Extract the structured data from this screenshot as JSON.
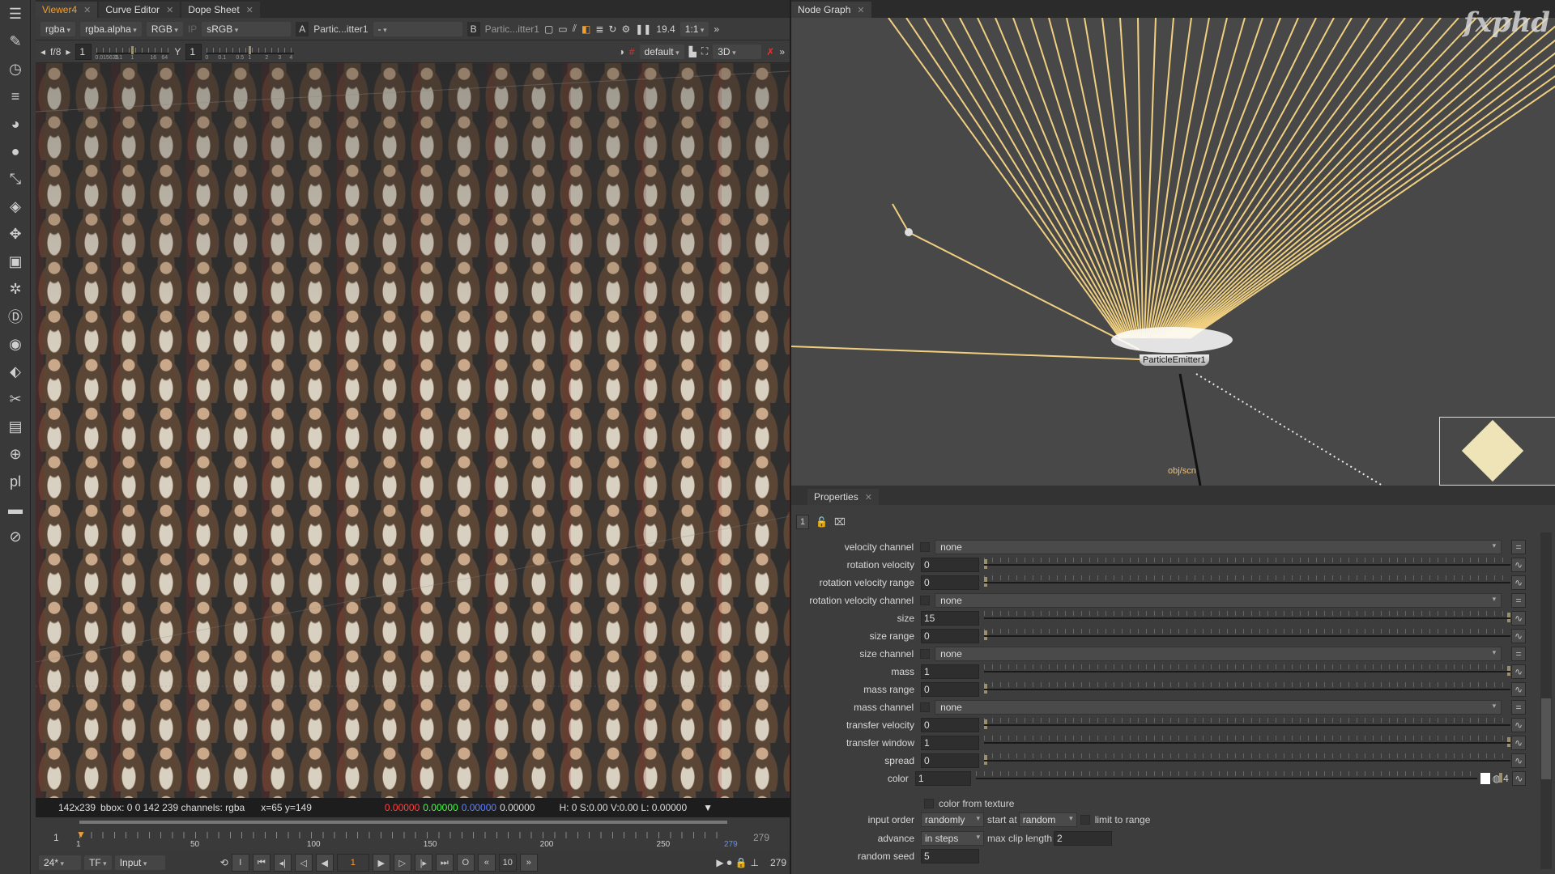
{
  "viewer": {
    "tabs": [
      {
        "label": "Viewer4",
        "active": true
      },
      {
        "label": "Curve Editor"
      },
      {
        "label": "Dope Sheet"
      }
    ],
    "toolbar1": {
      "channels": "rgba",
      "alpha": "rgba.alpha",
      "colorspace": "RGB",
      "ip": "IP",
      "lut": "sRGB",
      "input_a_label": "A",
      "input_a": "Partic...itter1",
      "a_op": "-",
      "input_b_label": "B",
      "input_b": "Partic...itter1",
      "fps": "19.4",
      "zoom": "1:1"
    },
    "toolbar2": {
      "fstop": "f/8",
      "gain": "1",
      "gamma_label": "Y",
      "gamma": "1",
      "gain_ticks": [
        "0.015625",
        "0.1",
        "1",
        "16",
        "64"
      ],
      "gamma_ticks": [
        "0",
        "0.1",
        "0.5",
        "1",
        "2",
        "3",
        "4"
      ],
      "view_mode": "default",
      "view3d": "3D"
    },
    "info": {
      "size": "142x239",
      "bbox": "bbox: 0 0 142 239 channels: rgba",
      "coords": "x=65 y=149",
      "r": "0.00000",
      "g": "0.00000",
      "b": "0.00000",
      "a": "0.00000",
      "hsv": "H:  0 S:0.00 V:0.00  L: 0.00000"
    },
    "timeline": {
      "start": "1",
      "end": "279",
      "current": "1",
      "ticks": [
        "1",
        "50",
        "100",
        "150",
        "200",
        "250",
        "279"
      ]
    },
    "controls": {
      "fps": "24*",
      "tf": "TF",
      "mode": "Input",
      "frame": "1",
      "step": "10",
      "end": "279"
    },
    "colors": {
      "accent": "#f0a030",
      "r": "#ff4040",
      "g": "#40ff40",
      "b": "#4060ff",
      "wire": "#f0d080"
    }
  },
  "nodegraph": {
    "tab": "Node Graph",
    "node": "ParticleEmitter1",
    "pipe_label": "obj/scn",
    "logo": "fxphd"
  },
  "properties": {
    "tab": "Properties",
    "count": "1",
    "rows": [
      {
        "label": "velocity channel",
        "type": "select",
        "value": "none"
      },
      {
        "label": "rotation velocity",
        "type": "slider",
        "value": "0",
        "level": 0
      },
      {
        "label": "rotation velocity range",
        "type": "slider",
        "value": "0",
        "level": 0
      },
      {
        "label": "rotation velocity channel",
        "type": "select",
        "value": "none"
      },
      {
        "label": "size",
        "type": "slider",
        "value": "15",
        "level": 1
      },
      {
        "label": "size range",
        "type": "slider",
        "value": "0",
        "level": 0
      },
      {
        "label": "size channel",
        "type": "select",
        "value": "none"
      },
      {
        "label": "mass",
        "type": "slider",
        "value": "1",
        "level": 1
      },
      {
        "label": "mass range",
        "type": "slider",
        "value": "0",
        "level": 0
      },
      {
        "label": "mass channel",
        "type": "select",
        "value": "none"
      },
      {
        "label": "transfer velocity",
        "type": "slider",
        "value": "0",
        "level": 0
      },
      {
        "label": "transfer window",
        "type": "slider",
        "value": "1",
        "level": 1
      },
      {
        "label": "spread",
        "type": "slider",
        "value": "0",
        "level": 0
      },
      {
        "label": "color",
        "type": "slider",
        "value": "1",
        "level": 1
      }
    ],
    "color_from_texture": "color from texture",
    "color_channels": "4",
    "input_order_label": "input order",
    "input_order": "randomly",
    "start_at_label": "start at",
    "start_at": "random",
    "limit_to_range": "limit to range",
    "advance_label": "advance",
    "advance": "in steps",
    "max_clip_label": "max clip length",
    "max_clip": "2",
    "seed_label": "random seed",
    "seed": "5"
  }
}
